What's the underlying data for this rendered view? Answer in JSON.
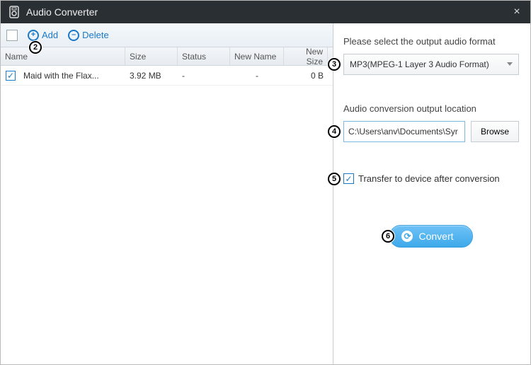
{
  "titlebar": {
    "title": "Audio Converter"
  },
  "toolbar": {
    "add_label": "Add",
    "delete_label": "Delete"
  },
  "table": {
    "headers": {
      "name": "Name",
      "size": "Size",
      "status": "Status",
      "newname": "New Name",
      "newsize": "New Size"
    },
    "row": {
      "checked": true,
      "name": "Maid with the Flax...",
      "size": "3.92 MB",
      "status": "-",
      "newname": "-",
      "newsize": "0 B"
    }
  },
  "right": {
    "format_label": "Please select the output audio format",
    "format_value": "MP3(MPEG-1 Layer 3 Audio Format)",
    "location_label": "Audio conversion output location",
    "path_value": "C:\\Users\\anv\\Documents\\Syr",
    "browse_label": "Browse",
    "transfer_label": "Transfer to device after conversion",
    "convert_label": "Convert"
  },
  "markers": {
    "m2": "2",
    "m3": "3",
    "m4": "4",
    "m5": "5",
    "m6": "6"
  }
}
